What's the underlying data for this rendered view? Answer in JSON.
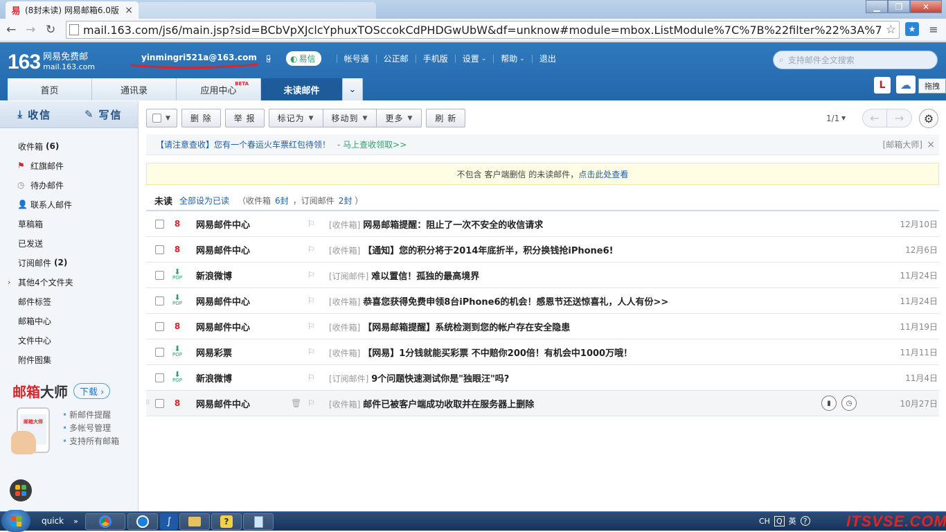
{
  "browser": {
    "tab_title": "(8封未读) 网易邮箱6.0版",
    "tab_close": "×",
    "url": "mail.163.com/js6/main.jsp?sid=BCbVpXJclcYphuxTOSccokCdPHDGwUbW&df=unknow#module=mbox.ListModule%7C%7B%22filter%22%3A%7B%22fla",
    "back_icon": "←",
    "forward_icon": "→",
    "reload_icon": "↻",
    "star_icon": "☆"
  },
  "header": {
    "logo_num": "163",
    "logo_name": "网易免费邮",
    "logo_domain": "mail.163.com",
    "user": "yinmingri521a@163.com",
    "user_caret": "⌄",
    "yixin": "易信",
    "links": [
      "帐号通",
      "公正邮",
      "手机版",
      "设置",
      "帮助",
      "退出"
    ],
    "search_placeholder": "支持邮件全文搜索",
    "right_l": "L",
    "right_t": "拖拽"
  },
  "nav": {
    "tabs": [
      "首页",
      "通讯录",
      "应用中心",
      "未读邮件"
    ],
    "beta": "BETA"
  },
  "sidebar": {
    "receive": "收信",
    "compose": "写信",
    "folders": [
      {
        "label": "收件箱",
        "count": "(6)"
      },
      {
        "label": "红旗邮件",
        "count": ""
      },
      {
        "label": "待办邮件",
        "count": ""
      },
      {
        "label": "联系人邮件",
        "count": ""
      },
      {
        "label": "草稿箱",
        "count": ""
      },
      {
        "label": "已发送",
        "count": ""
      },
      {
        "label": "订阅邮件",
        "count": "(2)"
      },
      {
        "label": "其他4个文件夹",
        "count": ""
      },
      {
        "label": "邮件标签",
        "count": ""
      },
      {
        "label": "邮箱中心",
        "count": ""
      },
      {
        "label": "文件中心",
        "count": ""
      },
      {
        "label": "附件图集",
        "count": ""
      }
    ],
    "promo": {
      "brand1": "邮箱",
      "brand2": "大师",
      "download": "下载",
      "phone_text": "邮箱大师",
      "features": [
        "新邮件提醒",
        "多帐号管理",
        "支持所有邮箱"
      ]
    }
  },
  "toolbar": {
    "delete": "删 除",
    "report": "举 报",
    "mark": "标记为",
    "move": "移动到",
    "more": "更多",
    "refresh": "刷 新",
    "pager": "1/1"
  },
  "notice": {
    "text": "【请注意查收】您有一个春运火车票红包待领！",
    "action": "- 马上查收领取>>",
    "source": "[邮箱大师]",
    "close": "×"
  },
  "yellow": {
    "text": "不包含 客户端删信 的未读邮件，",
    "link": "点击此处查看"
  },
  "unread": {
    "title": "未读",
    "mark_all": "全部设为已读",
    "inbox_prefix": "（收件箱",
    "inbox_count": "6封",
    "sub_prefix": "，订阅邮件",
    "sub_count": "2封",
    "close_paren": "）"
  },
  "emails": [
    {
      "icon": "163",
      "from": "网易邮件中心",
      "folder": "[收件箱]",
      "subject": "网易邮箱提醒：阻止了一次不安全的收信请求",
      "date": "12月10日"
    },
    {
      "icon": "163",
      "from": "网易邮件中心",
      "folder": "[收件箱]",
      "subject": "【通知】您的积分将于2014年底折半，积分换钱抢iPhone6!",
      "date": "12月6日"
    },
    {
      "icon": "pop",
      "from": "新浪微博",
      "folder": "[订阅邮件]",
      "subject": "难以置信！孤独的最高境界",
      "date": "11月24日"
    },
    {
      "icon": "pop",
      "from": "网易邮件中心",
      "folder": "[收件箱]",
      "subject": "恭喜您获得免费申领8台iPhone6的机会！感恩节还送惊喜礼，人人有份>>",
      "date": "11月24日"
    },
    {
      "icon": "163",
      "from": "网易邮件中心",
      "folder": "[收件箱]",
      "subject": "【网易邮箱提醒】系统检测到您的帐户存在安全隐患",
      "date": "11月19日"
    },
    {
      "icon": "pop",
      "from": "网易彩票",
      "folder": "[收件箱]",
      "subject": "【网易】1分钱就能买彩票 不中赔你200倍！有机会中1000万哦！",
      "date": "11月11日"
    },
    {
      "icon": "pop",
      "from": "新浪微博",
      "folder": "[订阅邮件]",
      "subject": "9个问题快速测试你是\"独眼汪\"吗?",
      "date": "11月4日"
    },
    {
      "icon": "163",
      "from": "网易邮件中心",
      "folder": "[收件箱]",
      "subject": "邮件已被客户端成功收取并在服务器上删除",
      "date": "10月27日"
    }
  ],
  "taskbar": {
    "quick": "quick",
    "chev": "»",
    "tray": [
      "CH",
      "英"
    ],
    "watermark": "ITSVSE.COM"
  },
  "colors": {
    "header_blue": "#2f79bd",
    "active_tab": "#1d5b9a",
    "brand_red": "#d9252a",
    "link_blue": "#1d5ea8",
    "green": "#2aa169"
  }
}
